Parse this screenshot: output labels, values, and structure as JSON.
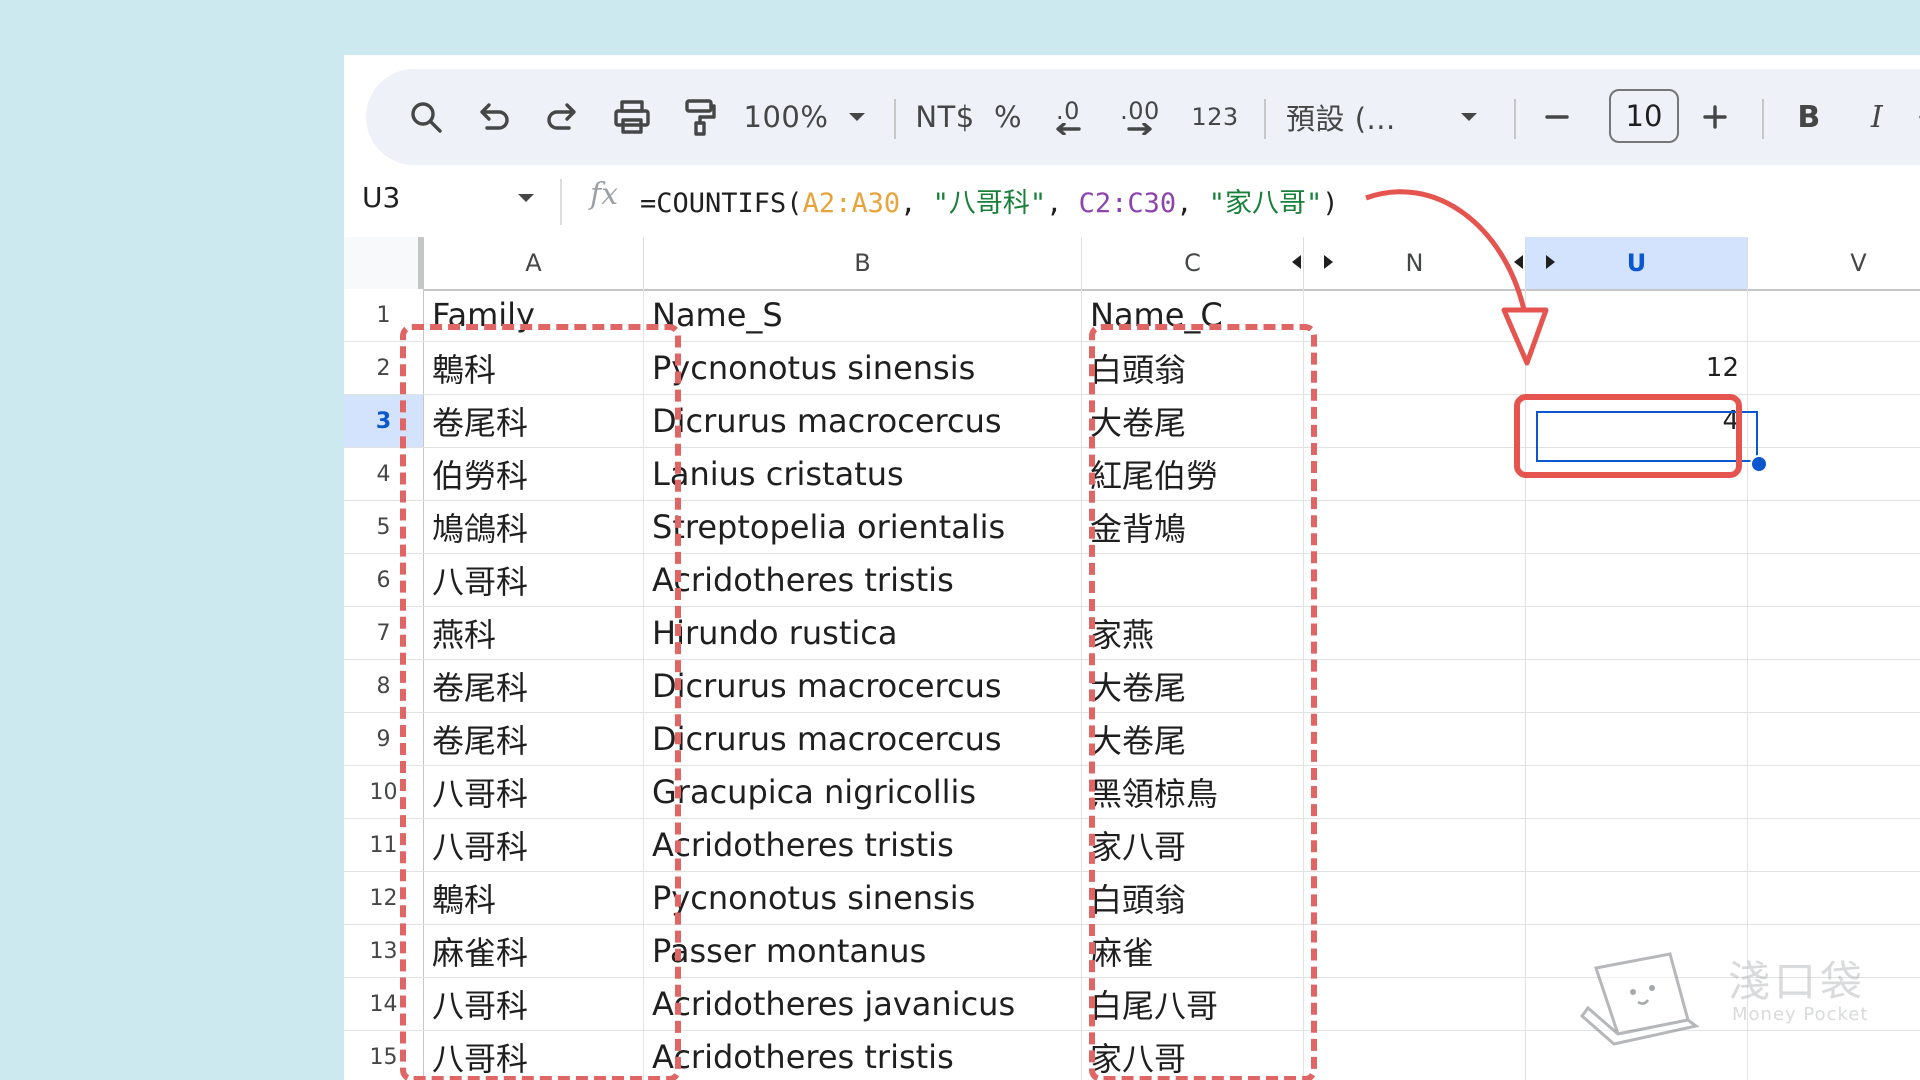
{
  "toolbar": {
    "zoom": "100%",
    "currency": "NT$",
    "percent": "%",
    "decimal_decrease": ".0",
    "decimal_increase": ".00",
    "number_format": "123",
    "font": "預設 (...",
    "font_size": "10",
    "bold": "B",
    "italic": "I"
  },
  "formula_bar": {
    "cell_ref": "U3",
    "fx": "fx",
    "formula_start": "=COUNTIFS(",
    "range1": "A2:A30",
    "sep1": ", ",
    "criteria1": "\"八哥科\"",
    "sep2": ", ",
    "range2": "C2:C30",
    "sep3": ", ",
    "criteria2": "\"家八哥\"",
    "formula_end": ")"
  },
  "columns": {
    "a": "A",
    "b": "B",
    "c": "C",
    "n": "N",
    "u": "U",
    "v": "V"
  },
  "rows": [
    {
      "num": "1",
      "a": "Family",
      "b": "Name_S",
      "c": "Name_C",
      "u": ""
    },
    {
      "num": "2",
      "a": "鵯科",
      "b": "Pycnonotus sinensis",
      "c": "白頭翁",
      "u": "12"
    },
    {
      "num": "3",
      "a": "卷尾科",
      "b": "Dicrurus macrocercus",
      "c": "大卷尾",
      "u": "4"
    },
    {
      "num": "4",
      "a": "伯勞科",
      "b": "Lanius cristatus",
      "c": "紅尾伯勞",
      "u": ""
    },
    {
      "num": "5",
      "a": "鳩鴿科",
      "b": "Streptopelia orientalis",
      "c": "金背鳩",
      "u": ""
    },
    {
      "num": "6",
      "a": "八哥科",
      "b": "Acridotheres tristis",
      "c": "",
      "u": ""
    },
    {
      "num": "7",
      "a": "燕科",
      "b": "Hirundo rustica",
      "c": "家燕",
      "u": ""
    },
    {
      "num": "8",
      "a": "卷尾科",
      "b": "Dicrurus macrocercus",
      "c": "大卷尾",
      "u": ""
    },
    {
      "num": "9",
      "a": "卷尾科",
      "b": "Dicrurus macrocercus",
      "c": "大卷尾",
      "u": ""
    },
    {
      "num": "10",
      "a": "八哥科",
      "b": "Gracupica nigricollis",
      "c": "黑領椋鳥",
      "u": ""
    },
    {
      "num": "11",
      "a": "八哥科",
      "b": "Acridotheres tristis",
      "c": "家八哥",
      "u": ""
    },
    {
      "num": "12",
      "a": "鵯科",
      "b": "Pycnonotus sinensis",
      "c": "白頭翁",
      "u": ""
    },
    {
      "num": "13",
      "a": "麻雀科",
      "b": "Passer montanus",
      "c": "麻雀",
      "u": ""
    },
    {
      "num": "14",
      "a": "八哥科",
      "b": "Acridotheres javanicus",
      "c": "白尾八哥",
      "u": ""
    },
    {
      "num": "15",
      "a": "八哥科",
      "b": "Acridotheres tristis",
      "c": "家八哥",
      "u": ""
    }
  ],
  "selected_row": "3",
  "colors": {
    "background": "#cbe9ee",
    "annotation_red": "#e5544f",
    "selection_blue": "#0b57d0"
  },
  "watermark": {
    "text": "淺口袋",
    "sub": "Money Pocket"
  }
}
